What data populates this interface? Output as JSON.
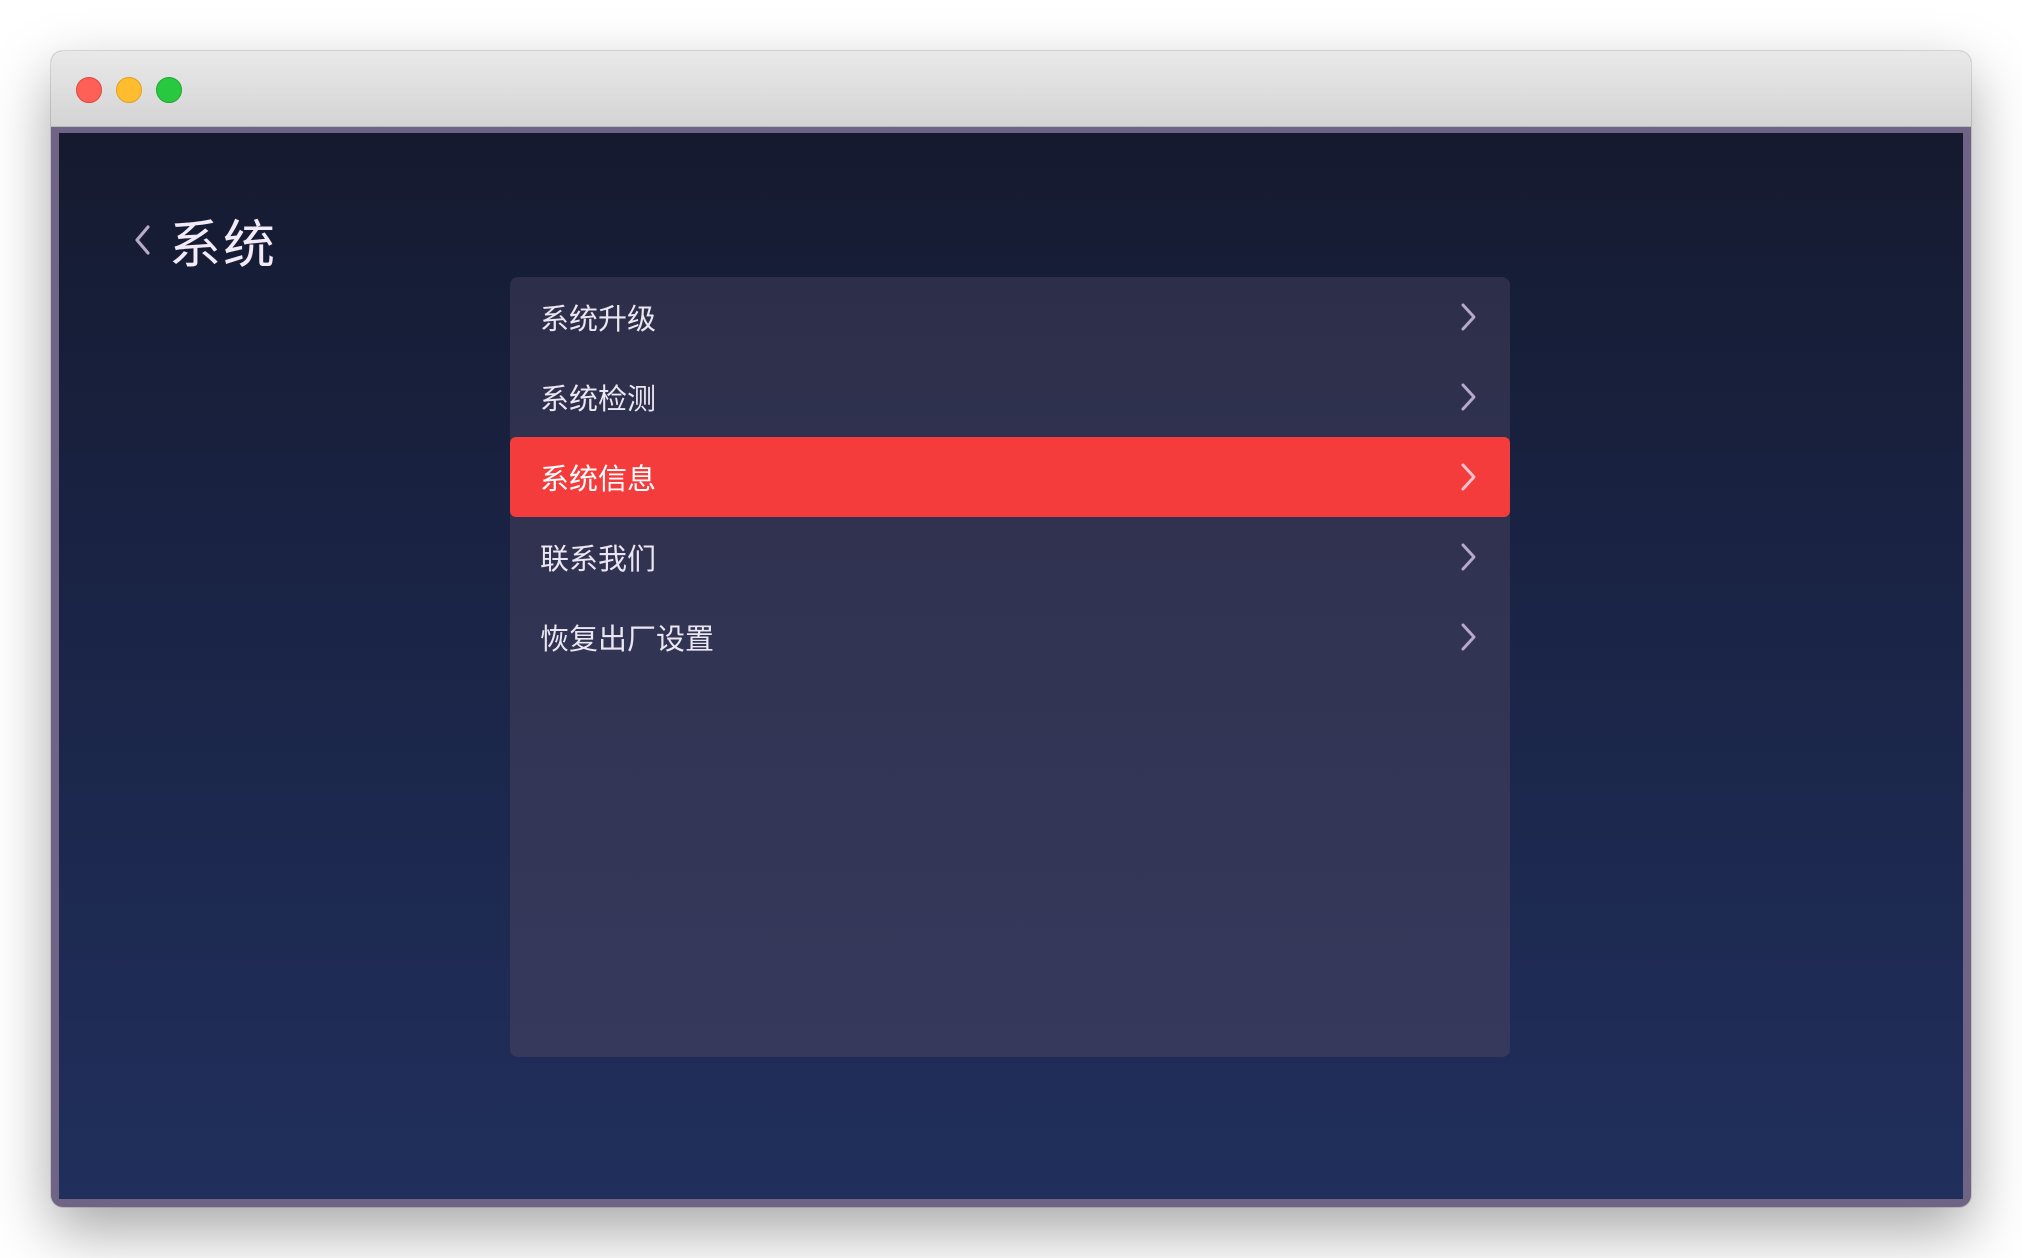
{
  "window": {
    "controls": [
      "close",
      "minimize",
      "maximize"
    ]
  },
  "header": {
    "back_icon": "chevron-left-icon",
    "title": "系统"
  },
  "menu": {
    "items": [
      {
        "label": "系统升级",
        "icon": "chevron-right-icon",
        "active": false
      },
      {
        "label": "系统检测",
        "icon": "chevron-right-icon",
        "active": false
      },
      {
        "label": "系统信息",
        "icon": "chevron-right-icon",
        "active": true
      },
      {
        "label": "联系我们",
        "icon": "chevron-right-icon",
        "active": false
      },
      {
        "label": "恢复出厂设置",
        "icon": "chevron-right-icon",
        "active": false
      }
    ]
  },
  "colors": {
    "accent": "#f43c3c",
    "background_top": "#151a2f",
    "background_bottom": "#202f5c",
    "panel": "#32355a",
    "text": "#eae6f2"
  }
}
